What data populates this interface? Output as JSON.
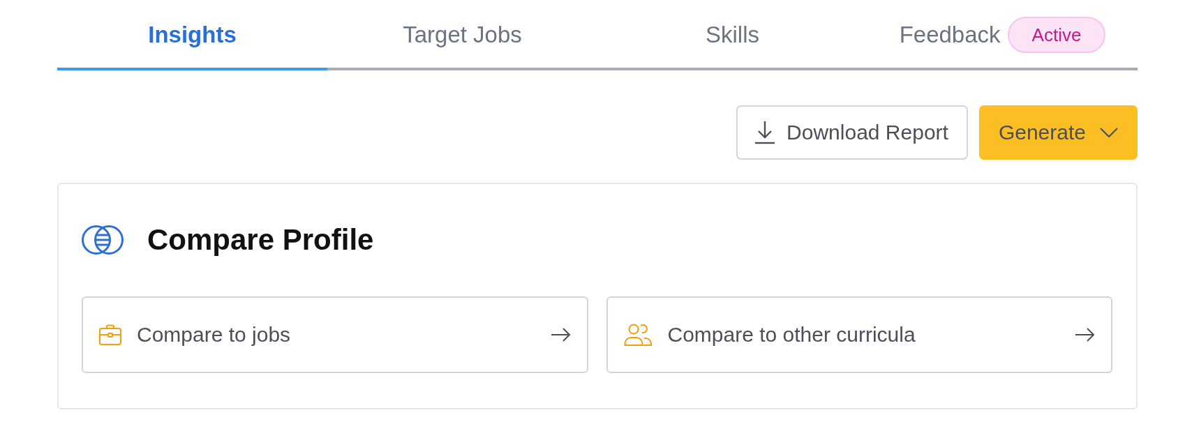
{
  "tabs": [
    {
      "label": "Insights",
      "selected": true
    },
    {
      "label": "Target Jobs",
      "selected": false
    },
    {
      "label": "Skills",
      "selected": false
    },
    {
      "label": "Feedback",
      "selected": false,
      "badge": "Active"
    }
  ],
  "actions": [
    {
      "kind": "download",
      "label": "Download Report"
    },
    {
      "kind": "dropdown",
      "label": "Generate"
    }
  ],
  "compare_profile": {
    "title": "Compare Profile",
    "options": [
      {
        "kind": "jobs",
        "label": "Compare to jobs"
      },
      {
        "kind": "curricula",
        "label": "Compare to other curricula"
      }
    ]
  }
}
